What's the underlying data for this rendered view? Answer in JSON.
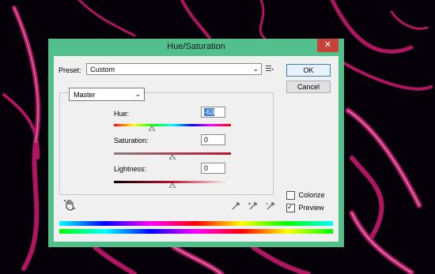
{
  "dialog": {
    "title": "Hue/Saturation",
    "close_glyph": "✕"
  },
  "preset": {
    "label": "Preset:",
    "value": "Custom",
    "menu_icon": "preset-options-icon"
  },
  "buttons": {
    "ok": "OK",
    "cancel": "Cancel"
  },
  "channel": {
    "value": "Master"
  },
  "hue": {
    "label": "Hue:",
    "value": "-63",
    "level": -63,
    "min": -180,
    "max": 180
  },
  "saturation": {
    "label": "Saturation:",
    "value": "0",
    "level": 0,
    "min": -100,
    "max": 100
  },
  "lightness": {
    "label": "Lightness:",
    "value": "0",
    "level": 0,
    "min": -100,
    "max": 100
  },
  "options": {
    "colorize": {
      "label": "Colorize",
      "checked": false
    },
    "preview": {
      "label": "Preview",
      "checked": true
    }
  },
  "colors": {
    "title_bar": "#52c08a",
    "close": "#c7433a",
    "client": "#f0f0f0",
    "selection": "#3a7fd6"
  }
}
